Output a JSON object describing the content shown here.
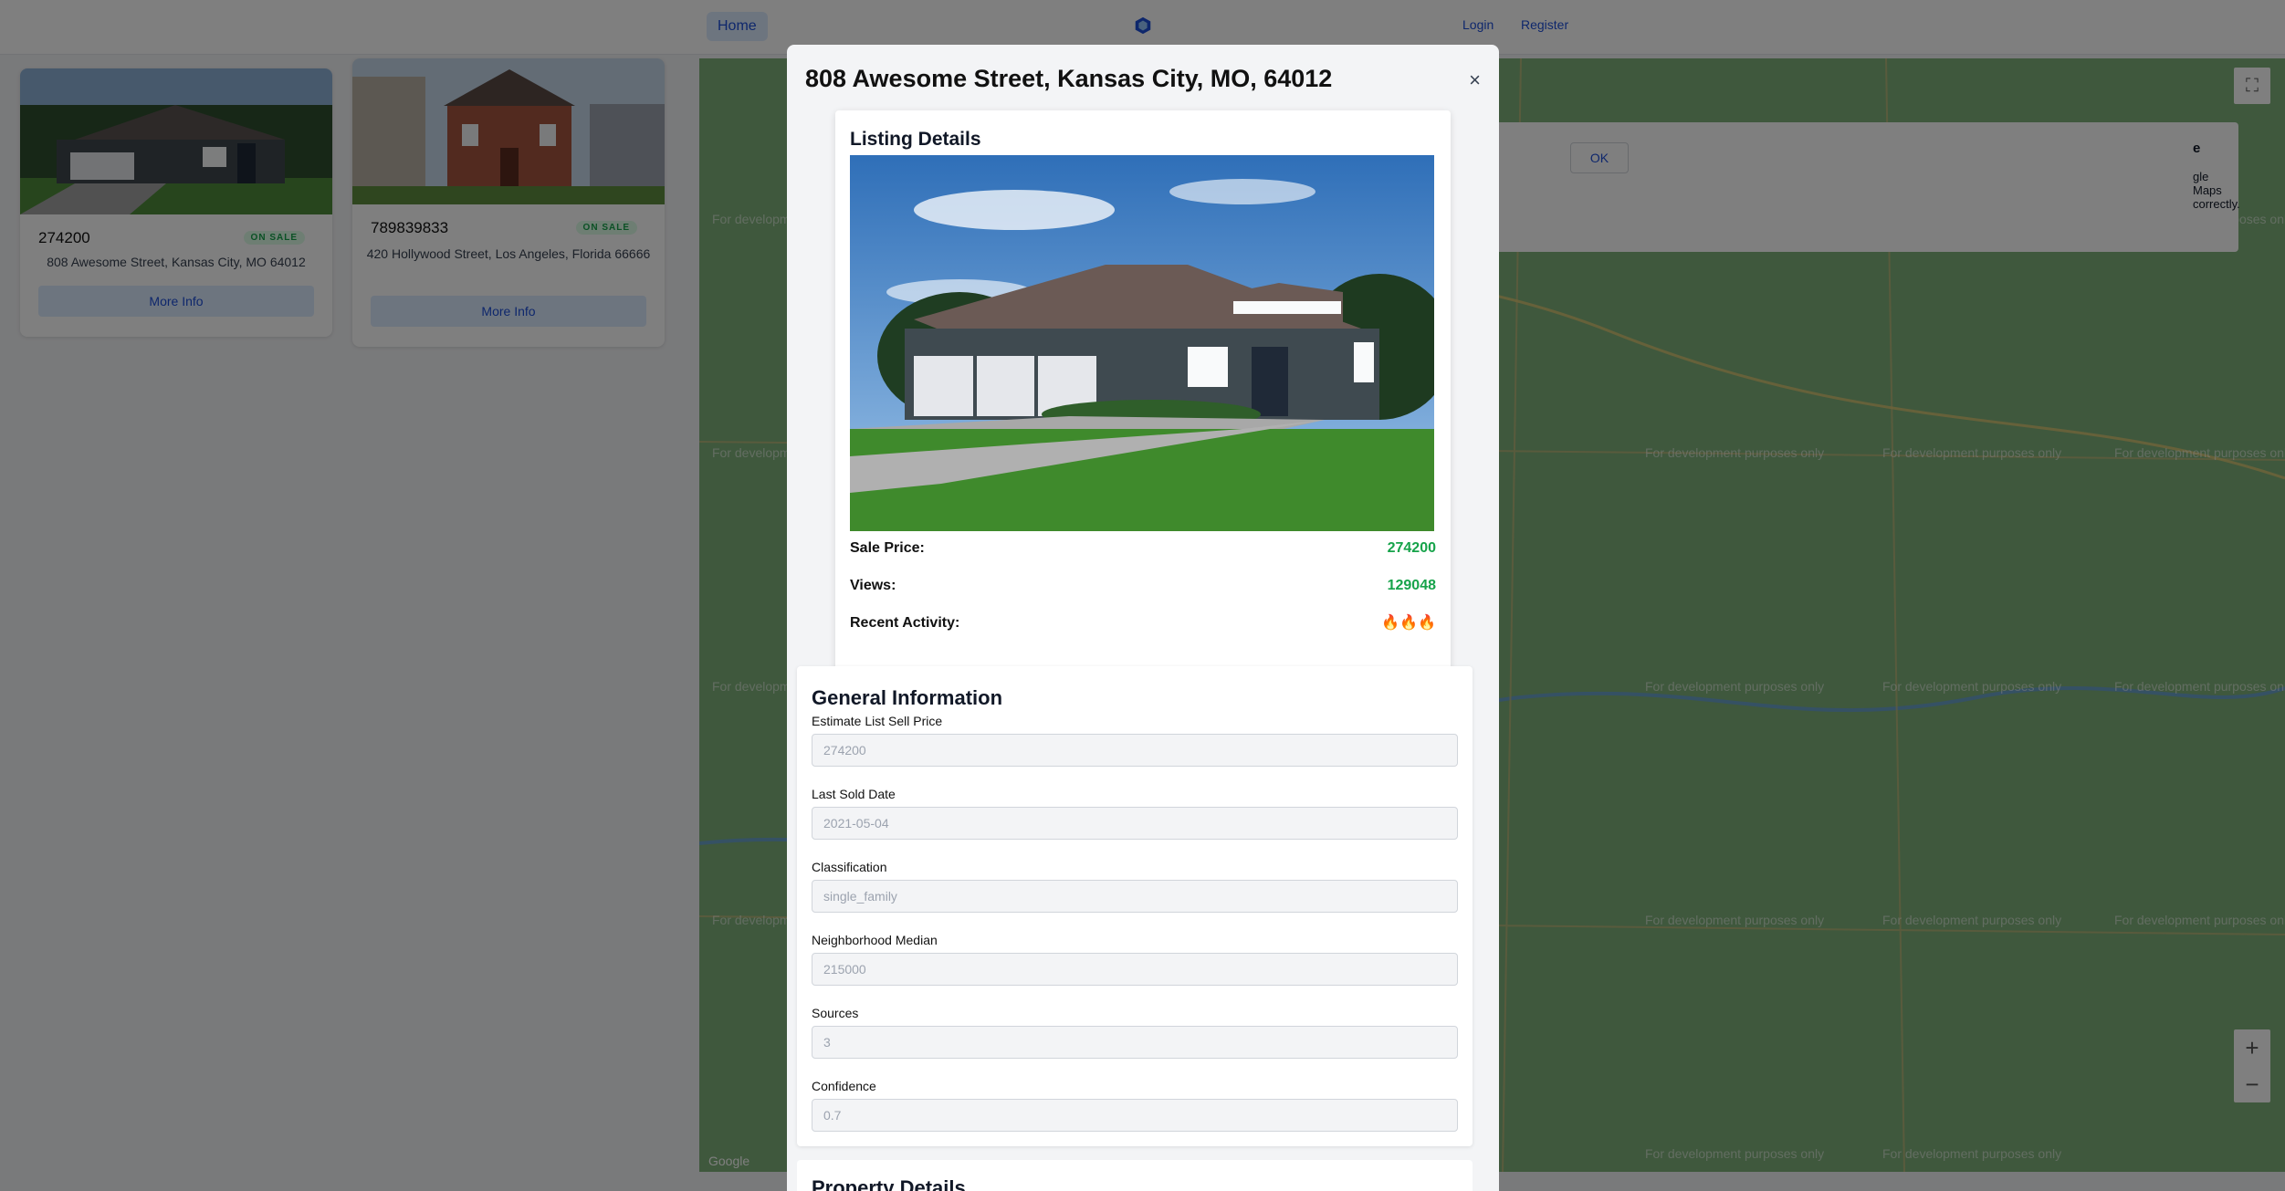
{
  "navbar": {
    "home_label": "Home",
    "login_label": "Login",
    "register_label": "Register"
  },
  "listings": [
    {
      "price": "274200",
      "status": "ON SALE",
      "address": "808 Awesome Street, Kansas City, MO 64012",
      "button": "More Info"
    },
    {
      "price": "789839833",
      "status": "ON SALE",
      "address": "420 Hollywood Street, Los Angeles, Florida 66666",
      "button": "More Info"
    }
  ],
  "map": {
    "watermark": "For development purposes only",
    "dialog_title": "e",
    "dialog_message": "gle Maps correctly.",
    "ok_label": "OK",
    "zoom_in": "+",
    "zoom_out": "−",
    "attribution": "Google"
  },
  "modal": {
    "title": "808 Awesome Street, Kansas City, MO, 64012",
    "close_glyph": "×",
    "listing_details": {
      "heading": "Listing Details",
      "sale_price_label": "Sale Price:",
      "sale_price_value": "274200",
      "views_label": "Views:",
      "views_value": "129048",
      "recent_activity_label": "Recent Activity:",
      "recent_activity_value": "🔥🔥🔥"
    },
    "general_information": {
      "heading": "General Information",
      "fields": [
        {
          "label": "Estimate List Sell Price",
          "value": "274200"
        },
        {
          "label": "Last Sold Date",
          "value": "2021-05-04"
        },
        {
          "label": "Classification",
          "value": "single_family"
        },
        {
          "label": "Neighborhood Median",
          "value": "215000"
        },
        {
          "label": "Sources",
          "value": "3"
        },
        {
          "label": "Confidence",
          "value": "0.7"
        }
      ]
    },
    "property_details": {
      "heading": "Property Details"
    }
  },
  "colors": {
    "accent": "#1d4ed8",
    "positive": "#16a34a",
    "overlay": "rgba(0,0,0,0.5)"
  }
}
